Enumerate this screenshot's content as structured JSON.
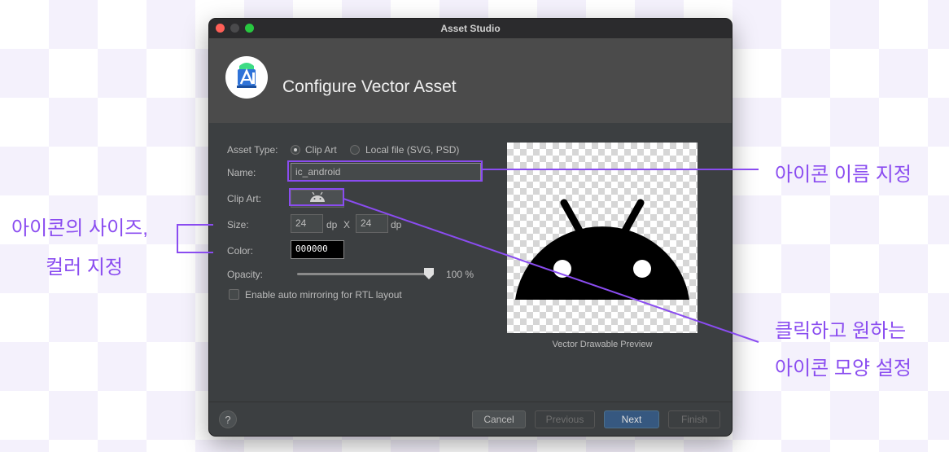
{
  "window": {
    "title": "Asset Studio",
    "header_title": "Configure Vector Asset"
  },
  "form": {
    "asset_type_label": "Asset Type:",
    "option_clip_art": "Clip Art",
    "option_local_file": "Local file (SVG, PSD)",
    "name_label": "Name:",
    "name_value": "ic_android",
    "clip_art_label": "Clip Art:",
    "size_label": "Size:",
    "width_value": "24",
    "height_value": "24",
    "dp_unit": "dp",
    "times_sign": "X",
    "color_label": "Color:",
    "color_value": "000000",
    "opacity_label": "Opacity:",
    "opacity_value": "100 %",
    "opacity_level": 1.0,
    "rtl_label": "Enable auto mirroring for RTL layout"
  },
  "preview": {
    "caption": "Vector Drawable Preview",
    "icon": "android-icon"
  },
  "footer": {
    "help": "?",
    "cancel": "Cancel",
    "previous": "Previous",
    "next": "Next",
    "finish": "Finish"
  },
  "annotations": {
    "name_note": "아이콘 이름 지정",
    "size_note_line1": "아이콘의 사이즈,",
    "size_note_line2": "컬러 지정",
    "clipart_note_line1": "클릭하고 원하는",
    "clipart_note_line2": "아이콘 모양 설정",
    "accent_color": "#8a4cf0"
  }
}
